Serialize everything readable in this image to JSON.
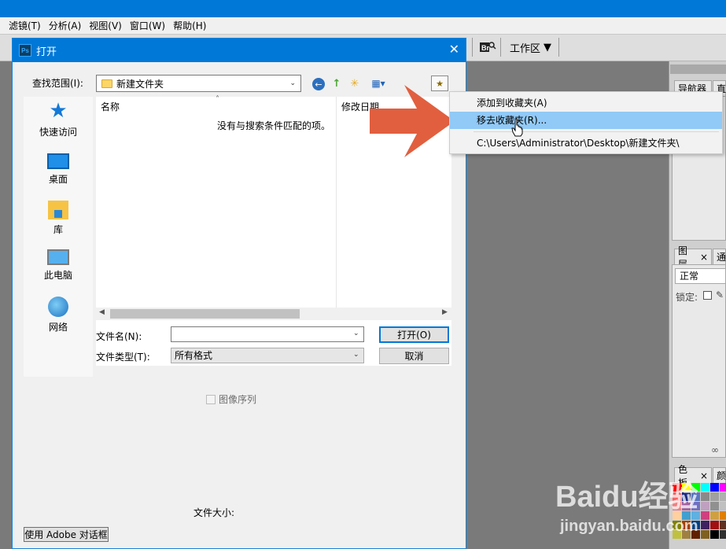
{
  "menu": [
    "滤镜(T)",
    "分析(A)",
    "视图(V)",
    "窗口(W)",
    "帮助(H)"
  ],
  "toolbar": {
    "bridge_icon": "bridge-icon",
    "workspace_label": "工作区"
  },
  "dock": {
    "tabs_top": [
      "导航器",
      "直"
    ],
    "tabs_layers": [
      "图层",
      "通"
    ],
    "tabs_color": [
      "色板",
      "颜"
    ],
    "blend_mode": "正常",
    "lock_label": "锁定:",
    "swatch_colors": [
      "#ff0000",
      "#ffff00",
      "#00ff00",
      "#00ffff",
      "#0000ff",
      "#ff00ff",
      "#ff6060",
      "#1b2a80",
      "#5a76bf",
      "#8a8a8a",
      "#a0a0a0",
      "#b0b0b0",
      "#f08080",
      "#a060a0",
      "#7070c0",
      "#c0a0c0",
      "#909090",
      "#c0c0c0",
      "#ffd0a0",
      "#40a0d0",
      "#60b0e0",
      "#d04080",
      "#d0a040",
      "#e08000",
      "#808000",
      "#a04000",
      "#004080",
      "#402060",
      "#a01010",
      "#603020",
      "#c0c040",
      "#a08040",
      "#602000",
      "#806020",
      "#000000",
      "#303030"
    ]
  },
  "dialog": {
    "title": "打开",
    "lookin_label": "查找范围(I):",
    "lookin_value": "新建文件夹",
    "col_name": "名称",
    "col_date": "修改日期",
    "empty_msg": "没有与搜索条件匹配的项。",
    "places": [
      "快速访问",
      "桌面",
      "库",
      "此电脑",
      "网络"
    ],
    "filename_label": "文件名(N):",
    "filename_value": "",
    "filetype_label": "文件类型(T):",
    "filetype_value": "所有格式",
    "open_btn": "打开(O)",
    "cancel_btn": "取消",
    "image_sequence_label": "图像序列",
    "filesize_label": "文件大小:",
    "adobe_dialog_btn": "使用 Adobe 对话框"
  },
  "context_menu": {
    "items": [
      "添加到收藏夹(A)",
      "移去收藏夹(R)...",
      "C:\\Users\\Administrator\\Desktop\\新建文件夹\\"
    ],
    "highlighted_index": 1
  },
  "watermark": {
    "logo": "Baidu经验",
    "url": "jingyan.baidu.com"
  },
  "colors": {
    "title_blue": "#0078d7",
    "arrow_red": "#e15f3f",
    "menu_highlight": "#91c9f7"
  }
}
